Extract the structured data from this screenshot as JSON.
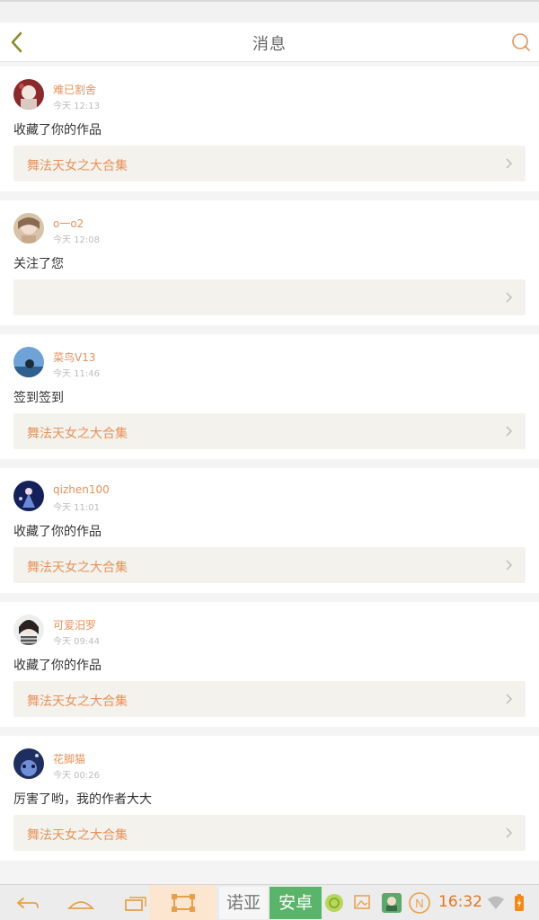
{
  "header": {
    "title": "消息"
  },
  "messages": [
    {
      "user": "难已割舍",
      "time": "今天 12:13",
      "action": "收藏了你的作品",
      "work": "舞法天女之大合集"
    },
    {
      "user": "o一o2",
      "time": "今天 12:08",
      "action": "关注了您",
      "work": ""
    },
    {
      "user": "菜鸟V13",
      "time": "今天 11:46",
      "action": "签到签到",
      "work": "舞法天女之大合集"
    },
    {
      "user": "qizhen100",
      "time": "今天 11:01",
      "action": "收藏了你的作品",
      "work": "舞法天女之大合集"
    },
    {
      "user": "可爱汨罗",
      "time": "今天 09:44",
      "action": "收藏了你的作品",
      "work": "舞法天女之大合集"
    },
    {
      "user": "花脚猫",
      "time": "今天 00:26",
      "action": "厉害了哟，我的作者大大",
      "work": "舞法天女之大合集"
    }
  ],
  "navbar": {
    "ime_left": "诺亚",
    "ime_right": "安卓",
    "clock": "16:32"
  },
  "colors": {
    "accent": "#e8915a",
    "card_link_bg": "#f3f2ec",
    "green": "#5ab56a"
  }
}
